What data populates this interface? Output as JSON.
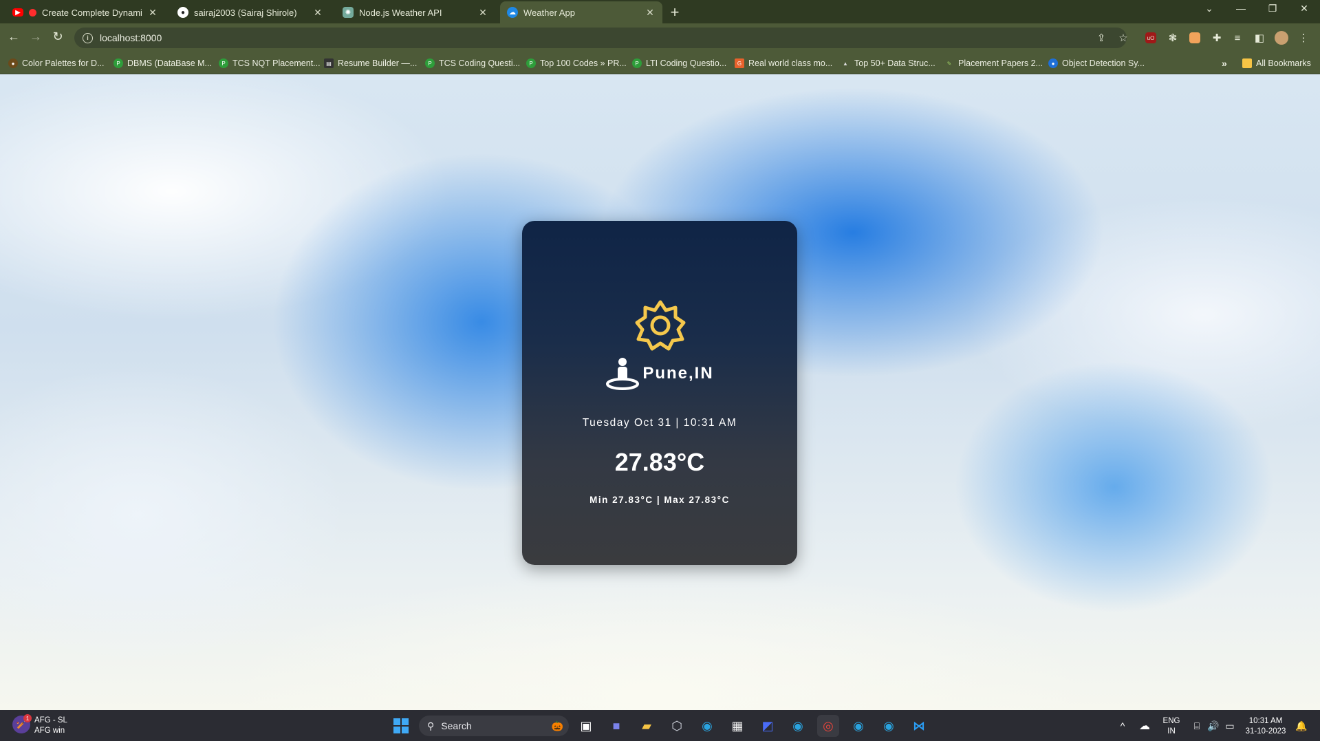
{
  "browser": {
    "tabs": [
      {
        "title": "Create Complete Dynamic W",
        "icon": "youtube-icon",
        "color": "#ff0000"
      },
      {
        "title": "sairaj2003 (Sairaj Shirole)",
        "icon": "github-icon",
        "color": "#ffffff"
      },
      {
        "title": "Node.js Weather API",
        "icon": "chatgpt-icon",
        "color": "#74aa9c"
      },
      {
        "title": "Weather App",
        "icon": "cloud-icon",
        "color": "#1e88e5"
      }
    ],
    "active_tab": 3,
    "url": "localhost:8000",
    "bookmarks": [
      "Color Palettes for D...",
      "DBMS (DataBase M...",
      "TCS NQT Placement...",
      "Resume Builder —...",
      "TCS Coding Questi...",
      "Top 100 Codes » PR...",
      "LTI Coding Questio...",
      "Real world class mo...",
      "Top 50+ Data Struc...",
      "Placement Papers 2...",
      "Object Detection Sy..."
    ],
    "all_bookmarks": "All Bookmarks",
    "overflow": "»"
  },
  "weather": {
    "icon": "sun-icon",
    "city": "Pune,IN",
    "datetime": "Tuesday Oct 31 | 10:31 AM",
    "temperature": "27.83°C",
    "minmax": "Min 27.83°C | Max 27.83°C",
    "accent_color": "#f5c84c"
  },
  "taskbar": {
    "widget_title": "AFG - SL",
    "widget_sub": "AFG win",
    "widget_badge": "1",
    "search_placeholder": "Search",
    "lang": "ENG",
    "region": "IN",
    "time": "10:31 AM",
    "date": "31-10-2023"
  }
}
